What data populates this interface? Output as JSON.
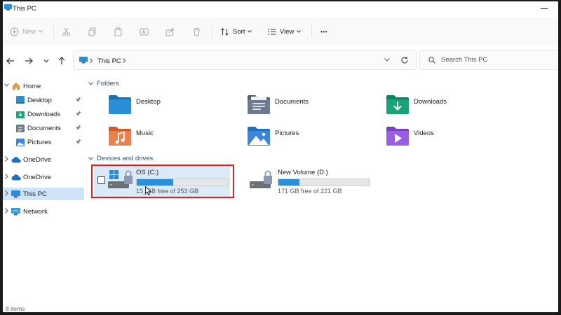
{
  "window": {
    "title": "This PC"
  },
  "toolbar": {
    "new_label": "New",
    "sort_label": "Sort",
    "view_label": "View",
    "more_label": "•••"
  },
  "address": {
    "crumb": "This PC",
    "search_placeholder": "Search This PC"
  },
  "sidebar": {
    "items": [
      {
        "label": "Home"
      },
      {
        "label": "Desktop"
      },
      {
        "label": "Downloads"
      },
      {
        "label": "Documents"
      },
      {
        "label": "Pictures"
      },
      {
        "label": "OneDrive"
      },
      {
        "label": "OneDrive"
      },
      {
        "label": "This PC"
      },
      {
        "label": "Network"
      }
    ]
  },
  "sections": {
    "folders": "Folders",
    "drives": "Devices and drives"
  },
  "folders": [
    {
      "name": "Desktop"
    },
    {
      "name": "Documents"
    },
    {
      "name": "Downloads"
    },
    {
      "name": "Music"
    },
    {
      "name": "Pictures"
    },
    {
      "name": "Videos"
    }
  ],
  "drives": [
    {
      "name": "OS (C:)",
      "free": "15_GB free of 253 GB",
      "used_fraction": 0.4
    },
    {
      "name": "New Volume (D:)",
      "free": "171 GB free of 221 GB",
      "used_fraction": 0.23
    }
  ],
  "status": {
    "items": "8 items"
  },
  "colors": {
    "accent": "#2a8fd6",
    "selection": "#cfe4f8",
    "highlight_box": "#e02020"
  }
}
